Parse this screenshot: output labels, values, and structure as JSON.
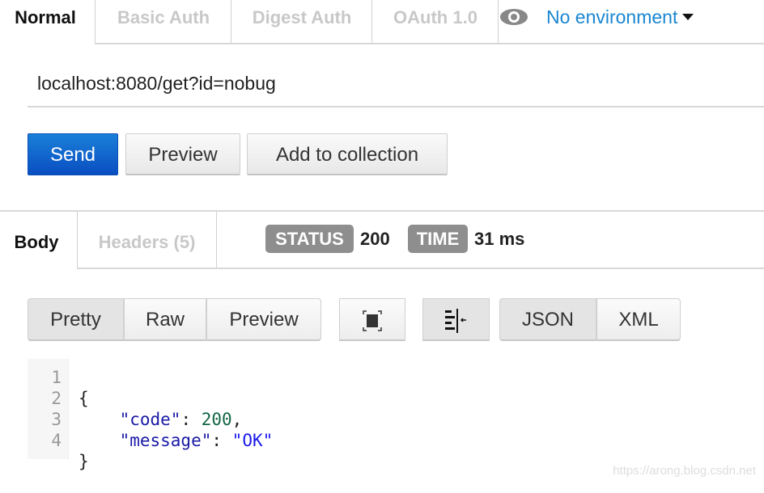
{
  "auth_tabs": [
    {
      "label": "Normal",
      "active": true
    },
    {
      "label": "Basic Auth"
    },
    {
      "label": "Digest Auth"
    },
    {
      "label": "OAuth 1.0"
    }
  ],
  "environment": {
    "icon": "eye-icon",
    "label": "No environment"
  },
  "url": "localhost:8080/get?id=nobug",
  "actions": {
    "send": "Send",
    "preview": "Preview",
    "add_to_collection": "Add to collection"
  },
  "response_tabs": [
    {
      "label": "Body",
      "active": true
    },
    {
      "label": "Headers (5)"
    }
  ],
  "status": {
    "label": "STATUS",
    "value": "200"
  },
  "time": {
    "label": "TIME",
    "value": "31 ms"
  },
  "view_modes": [
    {
      "label": "Pretty",
      "active": true
    },
    {
      "label": "Raw"
    },
    {
      "label": "Preview"
    }
  ],
  "tools": {
    "fullscreen": "fullscreen-icon",
    "wrap": "wrap-lines-icon"
  },
  "formats": [
    {
      "label": "JSON",
      "active": true
    },
    {
      "label": "XML"
    }
  ],
  "code": {
    "line_numbers": [
      "1",
      "2",
      "3",
      "4"
    ],
    "open": "{",
    "close": "}",
    "k1": "\"code\"",
    "v1": "200",
    "k2": "\"message\"",
    "v2": "\"OK\""
  },
  "watermark": "https://arong.blog.csdn.net"
}
